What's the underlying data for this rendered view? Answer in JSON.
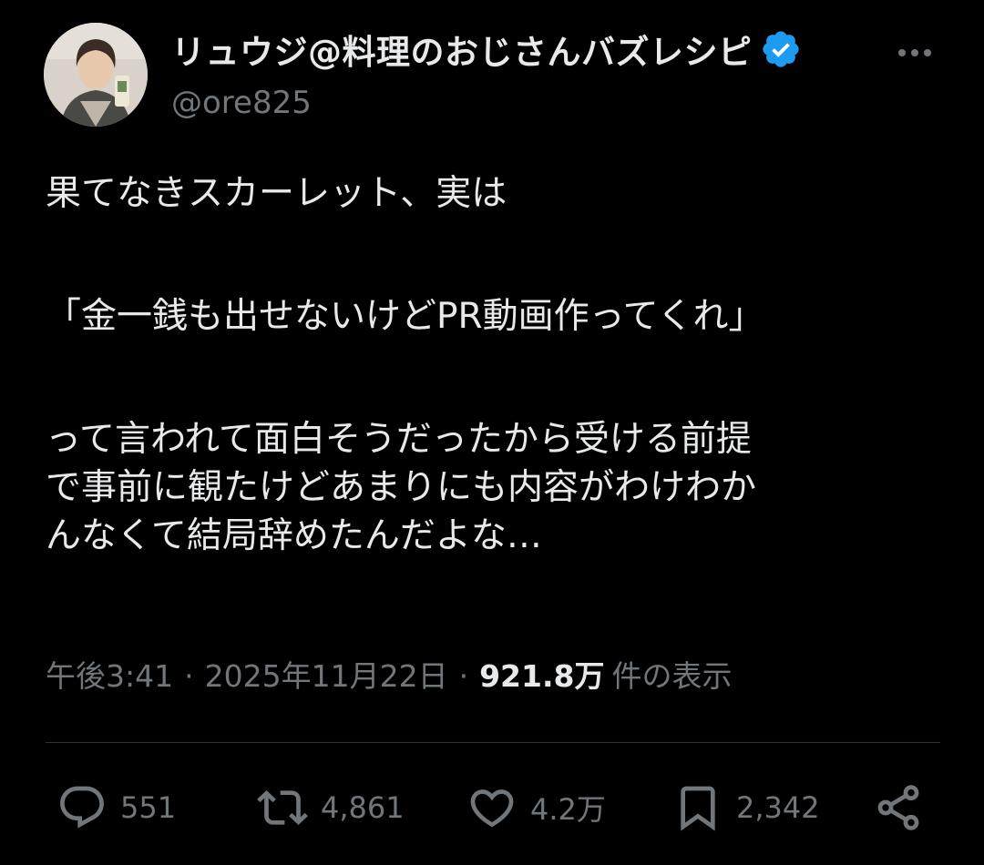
{
  "author": {
    "display_name": "リュウジ@料理のおじさんバズレシピ",
    "handle": "@ore825",
    "verified_icon": "verified-badge-icon",
    "verified_color": "#1d9bf0"
  },
  "tweet": {
    "paragraphs": [
      [
        "果てなきスカーレット、実は"
      ],
      [
        "「金一銭も出せないけどPR動画作ってくれ」"
      ],
      [
        "って言われて面白そうだったから受ける前提",
        "で事前に観たけどあまりにも内容がわけわか",
        "んなくて結局辞めたんだよな…"
      ]
    ]
  },
  "meta": {
    "time": "午後3:41",
    "separator": "·",
    "date": "2025年11月22日",
    "views_count": "921.8万",
    "views_label": "件の表示"
  },
  "actions": {
    "reply": {
      "icon": "reply-icon",
      "count": "551"
    },
    "retweet": {
      "icon": "retweet-icon",
      "count": "4,861"
    },
    "like": {
      "icon": "heart-icon",
      "count": "4.2万"
    },
    "bookmark": {
      "icon": "bookmark-icon",
      "count": "2,342"
    },
    "share": {
      "icon": "share-icon"
    }
  },
  "colors": {
    "background": "#000000",
    "text_primary": "#e7e9ea",
    "text_secondary": "#71767b",
    "divider": "#2f3336"
  }
}
